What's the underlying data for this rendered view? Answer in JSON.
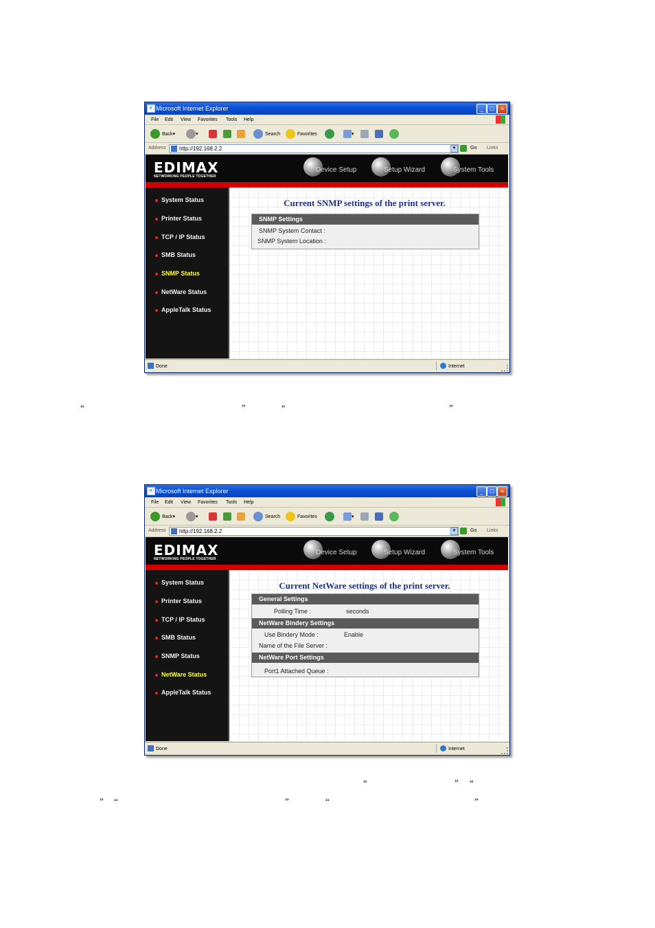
{
  "windows": [
    {
      "title": "Microsoft Internet Explorer",
      "menu": [
        "File",
        "Edit",
        "View",
        "Favorites",
        "Tools",
        "Help"
      ],
      "toolbar": {
        "back": "Back",
        "search": "Search",
        "favorites": "Favorites"
      },
      "address": {
        "label": "Address",
        "url": "http://192.168.2.2",
        "go": "Go",
        "links": "Links"
      },
      "header": {
        "logo": "EDIMAX",
        "tagline": "NETWORKING PEOPLE TOGETHER",
        "nav": [
          "Device Setup",
          "Setup Wizard",
          "System Tools"
        ]
      },
      "sidebar": [
        "System Status",
        "Printer Status",
        "TCP / IP Status",
        "SMB Status",
        "SNMP Status",
        "NetWare Status",
        "AppleTalk Status"
      ],
      "active_item": "SNMP Status",
      "main": {
        "title": "Current SNMP settings of the print server.",
        "sections": [
          {
            "header": "SNMP Settings",
            "rows": [
              "SNMP System Contact :",
              "SNMP System Location :"
            ]
          }
        ]
      },
      "status": {
        "left": "Done",
        "zone": "Internet"
      }
    },
    {
      "title": "Microsoft Internet Explorer",
      "menu": [
        "File",
        "Edit",
        "View",
        "Favorites",
        "Tools",
        "Help"
      ],
      "toolbar": {
        "back": "Back",
        "search": "Search",
        "favorites": "Favorites"
      },
      "address": {
        "label": "Address",
        "url": "http://192.168.2.2",
        "go": "Go",
        "links": "Links"
      },
      "header": {
        "logo": "EDIMAX",
        "tagline": "NETWORKING PEOPLE TOGETHER",
        "nav": [
          "Device Setup",
          "Setup Wizard",
          "System Tools"
        ]
      },
      "sidebar": [
        "System Status",
        "Printer Status",
        "TCP / IP Status",
        "SMB Status",
        "SNMP Status",
        "NetWare Status",
        "AppleTalk Status"
      ],
      "active_item": "NetWare Status",
      "main": {
        "title": "Current NetWare settings of the print server.",
        "sections": [
          {
            "header": "General Settings",
            "rows": [
              "Polling Time :",
              "seconds"
            ]
          },
          {
            "header": "NetWare Bindery Settings",
            "rows": [
              "Use Bindery Mode :",
              "Enable",
              "Name of the File Server :"
            ]
          },
          {
            "header": "NetWare Port Settings",
            "rows": [
              "Port1 Attached Queue :"
            ]
          }
        ]
      },
      "status": {
        "left": "Done",
        "zone": "Internet"
      }
    }
  ],
  "quotes": {
    "open": "“",
    "close": "”"
  }
}
